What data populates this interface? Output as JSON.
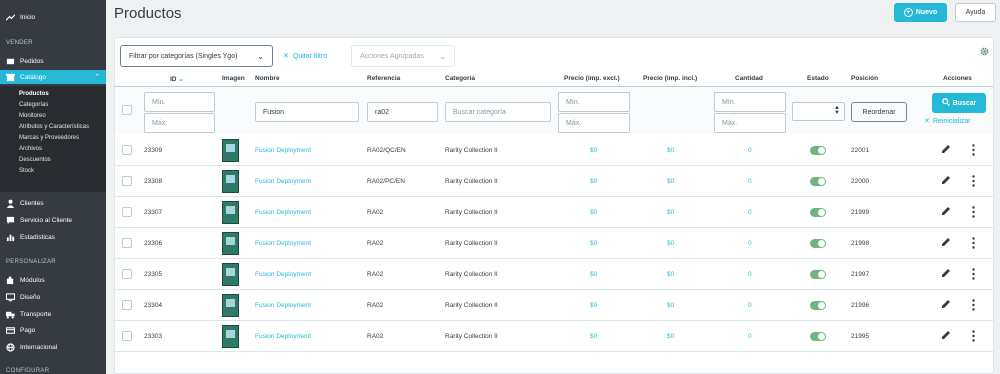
{
  "sidebar": {
    "inicio": "Inicio",
    "section_vender": "VENDER",
    "pedidos": "Pedidos",
    "catalogo": "Catálogo",
    "catalog_sub": [
      "Productos",
      "Categorías",
      "Monitoreo",
      "Atributos y Características",
      "Marcas y Proveedores",
      "Archivos",
      "Descuentos",
      "Stock"
    ],
    "clientes": "Clientes",
    "servicio": "Servicio al Cliente",
    "estadisticas": "Estadísticas",
    "section_personalizar": "PERSONALIZAR",
    "modulos": "Módulos",
    "diseno": "Diseño",
    "transporte": "Transporte",
    "pago": "Pago",
    "internacional": "Internacional",
    "section_configurar": "CONFIGURAR"
  },
  "header": {
    "title": "Productos",
    "new_label": "Nuevo",
    "help_label": "Ayuda"
  },
  "toolbar": {
    "category_filter": "Filtrar por categorías (Singles Ygo)",
    "remove_filter": "Quitar filtro",
    "bulk_actions": "Acciones Agrupadas"
  },
  "columns": {
    "id": "ID",
    "image": "Imagen",
    "name": "Nombre",
    "reference": "Referencia",
    "category": "Categoría",
    "price_excl": "Precio (imp. excl.)",
    "price_incl": "Precio (imp. incl.)",
    "quantity": "Cantidad",
    "status": "Estado",
    "position": "Posición",
    "actions": "Acciones"
  },
  "filters": {
    "id_min": "Mín.",
    "id_max": "Máx.",
    "name_value": "Fusion",
    "reference_value": "ra02",
    "category_placeholder": "Buscar categoría",
    "price_min": "Mín.",
    "price_max": "Máx.",
    "qty_min": "Mín.",
    "qty_max": "Máx.",
    "reorder_label": "Reordenar",
    "search_label": "Buscar",
    "reset_label": "Reinicializar"
  },
  "rows": [
    {
      "id": "23309",
      "name": "Fusion Deployment",
      "reference": "RA02/QC/EN",
      "category": "Rarity Collection II",
      "price_excl": "$0",
      "price_incl": "$0",
      "quantity": "0",
      "active": true,
      "position": "22001"
    },
    {
      "id": "23308",
      "name": "Fusion Deployment",
      "reference": "RA02/PC/EN",
      "category": "Rarity Collection II",
      "price_excl": "$0",
      "price_incl": "$0",
      "quantity": "0",
      "active": true,
      "position": "22000"
    },
    {
      "id": "23307",
      "name": "Fusion Deployment",
      "reference": "RA02",
      "category": "Rarity Collection II",
      "price_excl": "$0",
      "price_incl": "$0",
      "quantity": "0",
      "active": true,
      "position": "21999"
    },
    {
      "id": "23306",
      "name": "Fusion Deployment",
      "reference": "RA02",
      "category": "Rarity Collection II",
      "price_excl": "$0",
      "price_incl": "$0",
      "quantity": "0",
      "active": true,
      "position": "21998"
    },
    {
      "id": "23305",
      "name": "Fusion Deployment",
      "reference": "RA02",
      "category": "Rarity Collection II",
      "price_excl": "$0",
      "price_incl": "$0",
      "quantity": "0",
      "active": true,
      "position": "21997"
    },
    {
      "id": "23304",
      "name": "Fusion Deployment",
      "reference": "RA02",
      "category": "Rarity Collection II",
      "price_excl": "$0",
      "price_incl": "$0",
      "quantity": "0",
      "active": true,
      "position": "21996"
    },
    {
      "id": "23303",
      "name": "Fusion Deployment",
      "reference": "RA02",
      "category": "Rarity Collection II",
      "price_excl": "$0",
      "price_incl": "$0",
      "quantity": "0",
      "active": true,
      "position": "21995"
    }
  ],
  "colors": {
    "accent": "#25b9d7",
    "sidebar_bg": "#363a41",
    "toggle_on": "#70b580"
  }
}
